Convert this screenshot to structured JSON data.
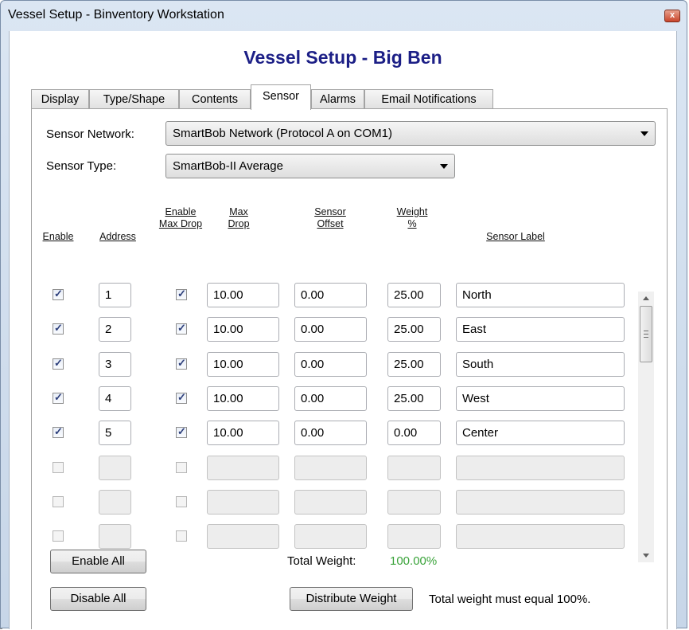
{
  "window": {
    "title": "Vessel Setup - Binventory Workstation",
    "close_glyph": "x"
  },
  "heading": "Vessel Setup - Big Ben",
  "tabs": [
    {
      "label": "Display"
    },
    {
      "label": "Type/Shape"
    },
    {
      "label": "Contents"
    },
    {
      "label": "Sensor",
      "active": true
    },
    {
      "label": "Alarms"
    },
    {
      "label": "Email Notifications"
    }
  ],
  "sensor_network": {
    "label": "Sensor Network:",
    "value": "SmartBob Network (Protocol A on COM1)"
  },
  "sensor_type": {
    "label": "Sensor Type:",
    "value": "SmartBob-II Average"
  },
  "columns": {
    "enable": "Enable",
    "address": "Address",
    "enable_max_drop": [
      "Enable",
      "Max Drop"
    ],
    "max_drop": [
      "Max",
      "Drop"
    ],
    "sensor_offset": [
      "Sensor",
      "Offset"
    ],
    "weight": [
      "Weight",
      "%"
    ],
    "sensor_label": "Sensor Label"
  },
  "rows": [
    {
      "enabled": true,
      "address": "1",
      "max_drop_enabled": true,
      "max_drop": "10.00",
      "offset": "0.00",
      "weight": "25.00",
      "label": "North"
    },
    {
      "enabled": true,
      "address": "2",
      "max_drop_enabled": true,
      "max_drop": "10.00",
      "offset": "0.00",
      "weight": "25.00",
      "label": "East"
    },
    {
      "enabled": true,
      "address": "3",
      "max_drop_enabled": true,
      "max_drop": "10.00",
      "offset": "0.00",
      "weight": "25.00",
      "label": "South"
    },
    {
      "enabled": true,
      "address": "4",
      "max_drop_enabled": true,
      "max_drop": "10.00",
      "offset": "0.00",
      "weight": "25.00",
      "label": "West"
    },
    {
      "enabled": true,
      "address": "5",
      "max_drop_enabled": true,
      "max_drop": "10.00",
      "offset": "0.00",
      "weight": "0.00",
      "label": "Center"
    },
    {
      "enabled": false,
      "address": "",
      "max_drop_enabled": false,
      "max_drop": "",
      "offset": "",
      "weight": "",
      "label": ""
    },
    {
      "enabled": false,
      "address": "",
      "max_drop_enabled": false,
      "max_drop": "",
      "offset": "",
      "weight": "",
      "label": ""
    },
    {
      "enabled": false,
      "address": "",
      "max_drop_enabled": false,
      "max_drop": "",
      "offset": "",
      "weight": "",
      "label": ""
    }
  ],
  "buttons": {
    "enable_all": "Enable All",
    "disable_all": "Disable All",
    "distribute_weight": "Distribute Weight"
  },
  "total_weight": {
    "label": "Total Weight:",
    "value": "100.00%",
    "value_color": "#3aa33a"
  },
  "note": "Total weight must equal 100%.",
  "colors": {
    "heading": "#1c1f86",
    "title_bar": "#c7d6e8"
  }
}
